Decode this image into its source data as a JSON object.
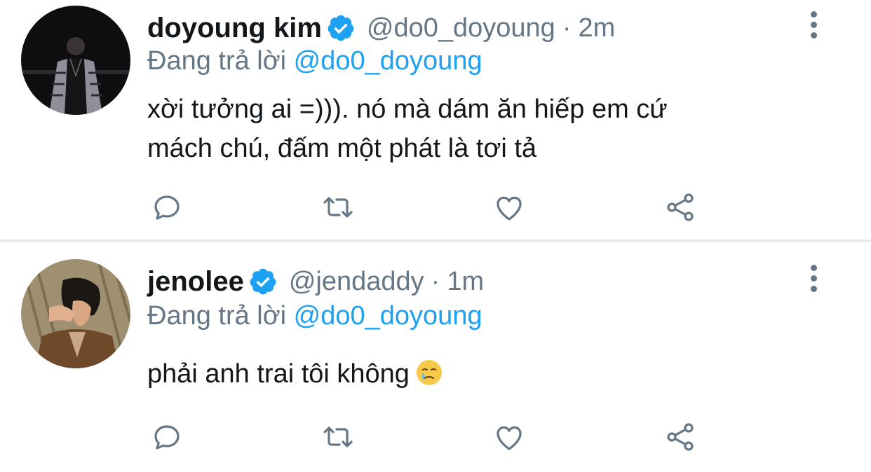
{
  "colors": {
    "text": "#14171a",
    "secondary": "#657786",
    "accent": "#1da1f2",
    "divider": "#e6ecf0"
  },
  "tweets": [
    {
      "display_name": "doyoung kim",
      "verified": true,
      "handle": "@do0_doyoung",
      "separator": "·",
      "time": "2m",
      "reply_prefix": "Đang trả lời",
      "reply_to": "@do0_doyoung",
      "text_line_1": "xời tưởng ai =))). nó mà dám ăn hiếp em cứ",
      "text_line_2": "mách chú, đấm một phát là tơi tả",
      "avatar_icon": "person-photo-dark-icon"
    },
    {
      "display_name": "jenolee",
      "verified": true,
      "handle": "@jendaddy",
      "separator": "·",
      "time": "1m",
      "reply_prefix": "Đang trả lời",
      "reply_to": "@do0_doyoung",
      "text": "phải anh trai tôi không",
      "emoji": "crying-face-emoji",
      "avatar_icon": "person-photo-tan-icon"
    }
  ],
  "actions": [
    "reply-icon",
    "retweet-icon",
    "like-icon",
    "share-icon"
  ]
}
